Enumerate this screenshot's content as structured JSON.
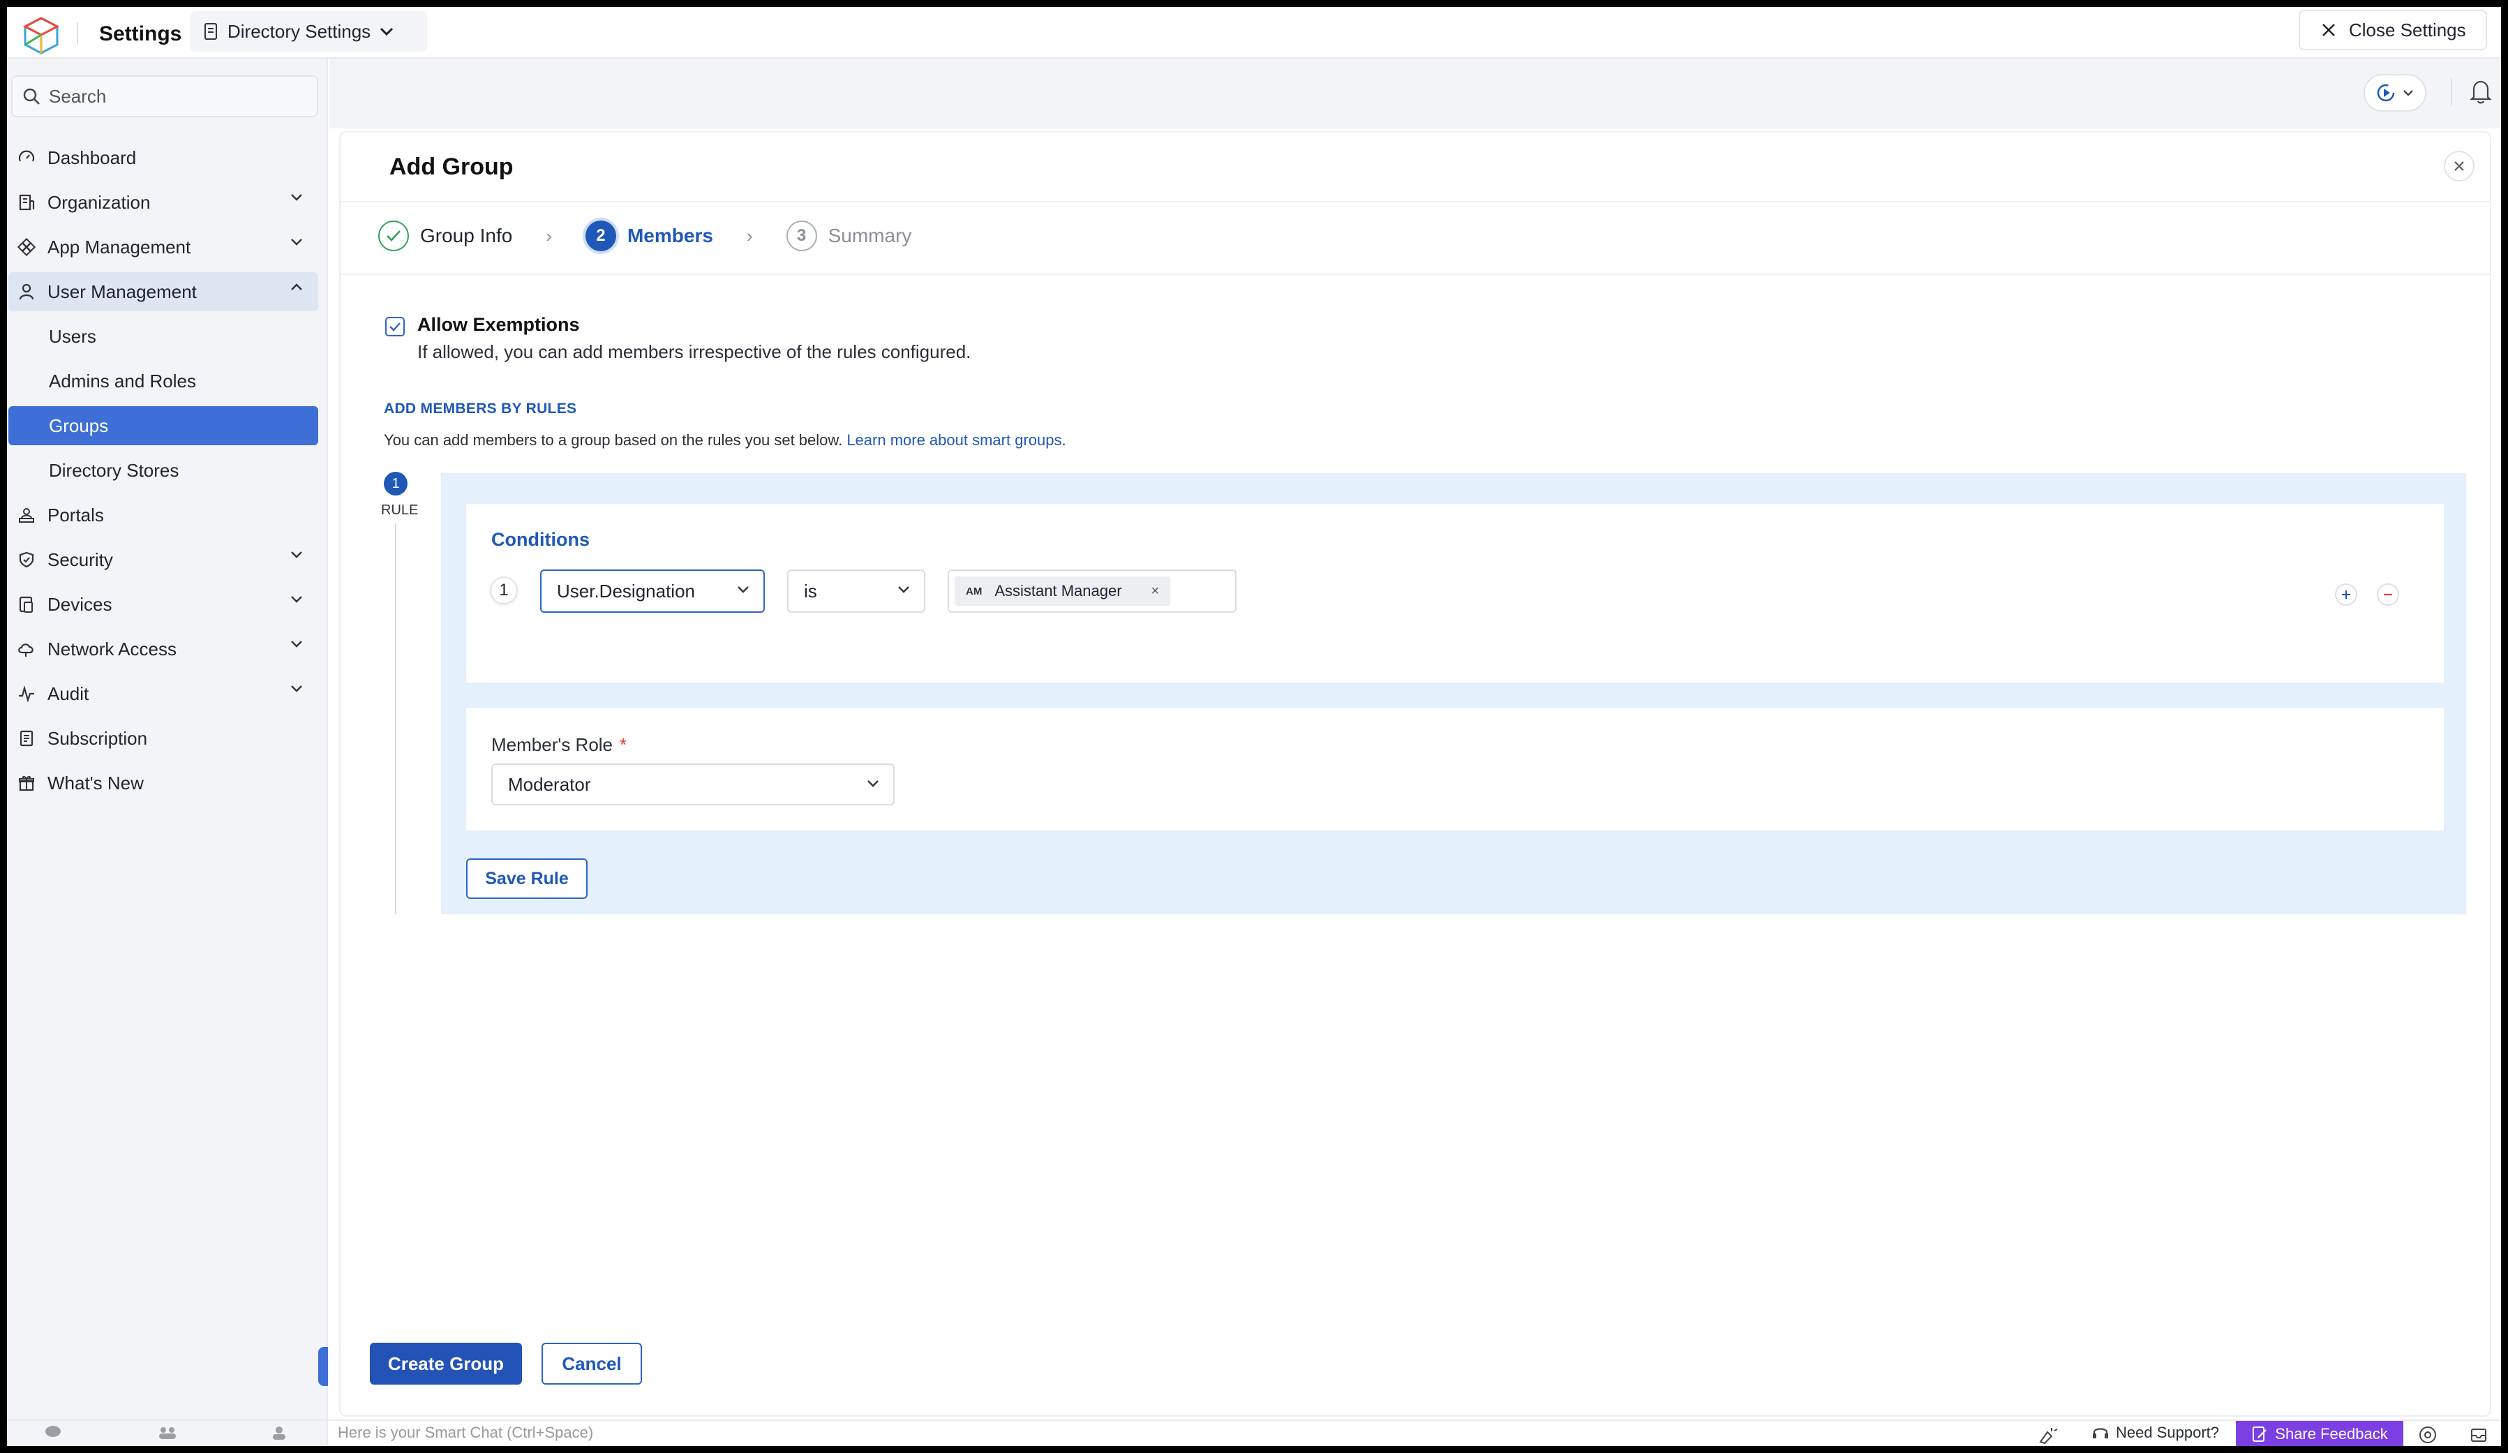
{
  "topbar": {
    "app_title": "Settings",
    "directory_selector": "Directory Settings",
    "close_settings": "Close Settings"
  },
  "sidebar": {
    "search_placeholder": "Search",
    "items": [
      {
        "label": "Dashboard",
        "icon": "gauge-icon"
      },
      {
        "label": "Organization",
        "icon": "building-icon"
      },
      {
        "label": "App Management",
        "icon": "apps-icon"
      },
      {
        "label": "User Management",
        "icon": "user-icon"
      },
      {
        "label": "Users"
      },
      {
        "label": "Admins and Roles"
      },
      {
        "label": "Groups"
      },
      {
        "label": "Directory Stores"
      },
      {
        "label": "Portals",
        "icon": "portal-icon"
      },
      {
        "label": "Security",
        "icon": "shield-icon"
      },
      {
        "label": "Devices",
        "icon": "devices-icon"
      },
      {
        "label": "Network Access",
        "icon": "cloud-icon"
      },
      {
        "label": "Audit",
        "icon": "pulse-icon"
      },
      {
        "label": "Subscription",
        "icon": "receipt-icon"
      },
      {
        "label": "What's New",
        "icon": "gift-icon"
      }
    ]
  },
  "panel": {
    "title": "Add Group",
    "steps": [
      {
        "number": "1",
        "label": "Group Info",
        "state": "done"
      },
      {
        "number": "2",
        "label": "Members",
        "state": "current"
      },
      {
        "number": "3",
        "label": "Summary",
        "state": "pending"
      }
    ],
    "exemption": {
      "title": "Allow Exemptions",
      "description": "If allowed, you can add members irrespective of the rules configured.",
      "checked": true
    },
    "rules_section": {
      "heading": "ADD MEMBERS BY RULES",
      "description": "You can add members to a group based on the rules you set below.",
      "link": "Learn more about smart groups",
      "period": "."
    },
    "rule": {
      "number": "1",
      "label": "RULE",
      "conditions_title": "Conditions",
      "condition": {
        "index": "1",
        "field": "User.Designation",
        "operator": "is",
        "value_abbr": "AM",
        "value": "Assistant Manager"
      },
      "role_label": "Member's Role",
      "role_required": "*",
      "role_value": "Moderator",
      "save_label": "Save Rule"
    },
    "create_label": "Create Group",
    "cancel_label": "Cancel"
  },
  "bottombar": {
    "smart_chat": "Here is your Smart Chat (Ctrl+Space)",
    "support": "Need Support?",
    "feedback": "Share Feedback"
  },
  "colors": {
    "accent": "#1f58b8",
    "selected_nav": "#3d6fd6",
    "rule_bg": "#e4f0fb",
    "feedback": "#7b3fe4",
    "success": "#2fa35a"
  }
}
